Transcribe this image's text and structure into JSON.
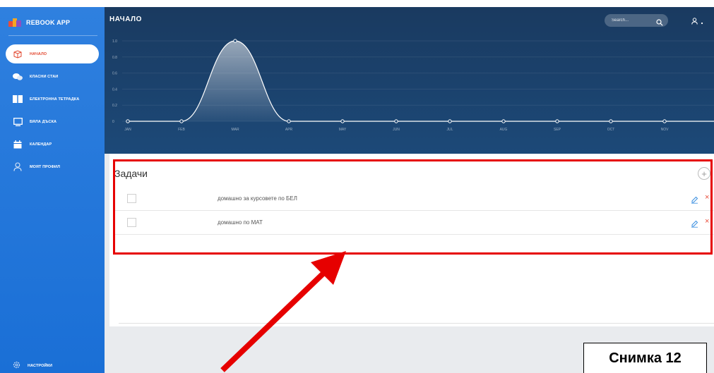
{
  "app": {
    "name": "REBOOK APP"
  },
  "sidebar": {
    "items": [
      {
        "label": "НАЧАЛО",
        "icon": "cube-icon",
        "active": true
      },
      {
        "label": "КЛАСНИ СТАИ",
        "icon": "chat-icon",
        "active": false
      },
      {
        "label": "ЕЛЕКТРОННА ТЕТРАДКА",
        "icon": "book-icon",
        "active": false
      },
      {
        "label": "БЯЛА ДЪСКА",
        "icon": "board-icon",
        "active": false
      },
      {
        "label": "КАЛЕНДАР",
        "icon": "calendar-icon",
        "active": false
      },
      {
        "label": "МОЯТ ПРОФИЛ",
        "icon": "user-icon",
        "active": false
      }
    ],
    "settings_label": "НАСТРОЙКИ"
  },
  "header": {
    "title": "НАЧАЛО",
    "search_placeholder": "Search..."
  },
  "chart_data": {
    "type": "area",
    "categories": [
      "JAN",
      "FEB",
      "MAR",
      "APR",
      "MAY",
      "JUN",
      "JUL",
      "AUG",
      "SEP",
      "OCT",
      "NOV",
      "DEC"
    ],
    "values": [
      0,
      0,
      1,
      0,
      0,
      0,
      0,
      0,
      0,
      0,
      0,
      0
    ],
    "yticks": [
      "1.0",
      "0.8",
      "0.6",
      "0.4",
      "0.2",
      "0"
    ],
    "ylim": [
      0,
      1
    ]
  },
  "tasks": {
    "title": "Задачи",
    "add_symbol": "+",
    "delete_symbol": "×",
    "items": [
      {
        "text": "домашно за курсовете по БЕЛ"
      },
      {
        "text": "домашно по МАТ"
      }
    ]
  },
  "annotation": {
    "caption": "Снимка 12"
  },
  "colors": {
    "sidebar": "#1f74da",
    "header": "#1b3f68",
    "accent_red": "#e94d3a",
    "highlight": "#e60000"
  }
}
